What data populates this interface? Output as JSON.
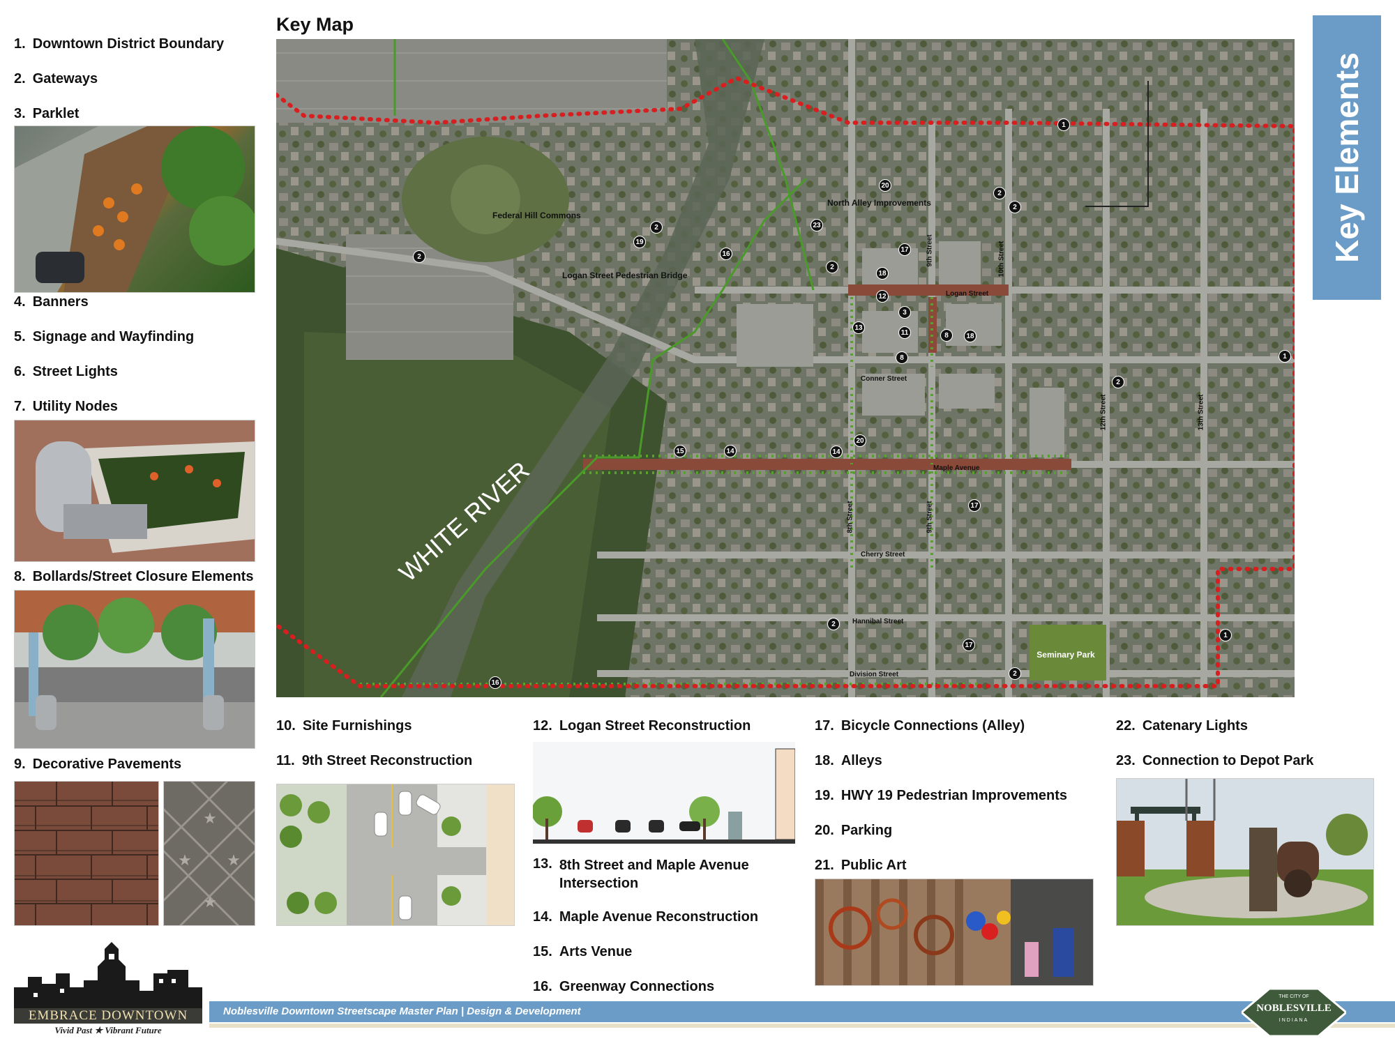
{
  "map_title": "Key Map",
  "sidebar_title": "Key Elements",
  "footer": {
    "banner_text": "Noblesville Downtown Streetscape Master Plan | Design & Development",
    "logo_title": "EMBRACE DOWNTOWN",
    "logo_tagline": "Vivid Past ★ Vibrant Future",
    "city_badge_top": "THE CITY OF",
    "city_badge_name": "NOBLESVILLE",
    "city_badge_state": "INDIANA"
  },
  "elements": [
    {
      "num": "1.",
      "label": "Downtown District Boundary"
    },
    {
      "num": "2.",
      "label": "Gateways"
    },
    {
      "num": "3.",
      "label": "Parklet"
    },
    {
      "num": "4.",
      "label": "Banners"
    },
    {
      "num": "5.",
      "label": "Signage and Wayfinding"
    },
    {
      "num": "6.",
      "label": "Street Lights"
    },
    {
      "num": "7.",
      "label": "Utility Nodes"
    },
    {
      "num": "8.",
      "label": "Bollards/Street Closure Elements"
    },
    {
      "num": "9.",
      "label": "Decorative Pavements"
    },
    {
      "num": "10.",
      "label": "Site Furnishings"
    },
    {
      "num": "11.",
      "label": "9th Street Reconstruction"
    },
    {
      "num": "12.",
      "label": "Logan Street Reconstruction"
    },
    {
      "num": "13.",
      "label": "8th Street and Maple Avenue Intersection"
    },
    {
      "num": "14.",
      "label": "Maple Avenue Reconstruction"
    },
    {
      "num": "15.",
      "label": "Arts Venue"
    },
    {
      "num": "16.",
      "label": "Greenway Connections"
    },
    {
      "num": "17.",
      "label": "Bicycle Connections (Alley)"
    },
    {
      "num": "18.",
      "label": "Alleys"
    },
    {
      "num": "19.",
      "label": "HWY 19 Pedestrian Improvements"
    },
    {
      "num": "20.",
      "label": "Parking"
    },
    {
      "num": "21.",
      "label": "Public Art"
    },
    {
      "num": "22.",
      "label": "Catenary Lights"
    },
    {
      "num": "23.",
      "label": "Connection to Depot Park"
    }
  ],
  "map_labels": {
    "river": "WHITE RIVER",
    "federal_hill": "Federal Hill Commons",
    "bridge": "Logan Street Pedestrian Bridge",
    "north_alley": "North Alley Improvements",
    "logan_street": "Logan Street",
    "conner_street": "Conner Street",
    "maple_avenue": "Maple Avenue",
    "cherry_street": "Cherry Street",
    "hannibal_street": "Hannibal Street",
    "division_street": "Division Street",
    "seminary_park": "Seminary Park",
    "ninth_street": "9th Street",
    "eighth_street": "8th Street",
    "tenth_street": "10th Street",
    "twelfth_street": "12th Street",
    "thirteenth_street": "13th Street"
  },
  "map_markers": [
    {
      "id": "1",
      "n": "1"
    },
    {
      "id": "2",
      "n": "1"
    },
    {
      "id": "3",
      "n": "1"
    },
    {
      "id": "4",
      "n": "2"
    },
    {
      "id": "5",
      "n": "2"
    },
    {
      "id": "6",
      "n": "2"
    },
    {
      "id": "7",
      "n": "2"
    },
    {
      "id": "8",
      "n": "2"
    },
    {
      "id": "9",
      "n": "2"
    },
    {
      "id": "10",
      "n": "2"
    },
    {
      "id": "11",
      "n": "2"
    },
    {
      "id": "12",
      "n": "3"
    },
    {
      "id": "13",
      "n": "8"
    },
    {
      "id": "14",
      "n": "8"
    },
    {
      "id": "15",
      "n": "11"
    },
    {
      "id": "16",
      "n": "12"
    },
    {
      "id": "17",
      "n": "13"
    },
    {
      "id": "18",
      "n": "14"
    },
    {
      "id": "19",
      "n": "14"
    },
    {
      "id": "20",
      "n": "15"
    },
    {
      "id": "21",
      "n": "16"
    },
    {
      "id": "22",
      "n": "16"
    },
    {
      "id": "23",
      "n": "17"
    },
    {
      "id": "24",
      "n": "17"
    },
    {
      "id": "25",
      "n": "17"
    },
    {
      "id": "26",
      "n": "18"
    },
    {
      "id": "27",
      "n": "18"
    },
    {
      "id": "28",
      "n": "19"
    },
    {
      "id": "29",
      "n": "20"
    },
    {
      "id": "30",
      "n": "20"
    },
    {
      "id": "31",
      "n": "23"
    }
  ],
  "colors": {
    "accent_blue": "#6a9cc7",
    "boundary_red": "#d81e1e",
    "greenway_green": "#4a9a2a",
    "street_brown": "#8a4a3a"
  }
}
